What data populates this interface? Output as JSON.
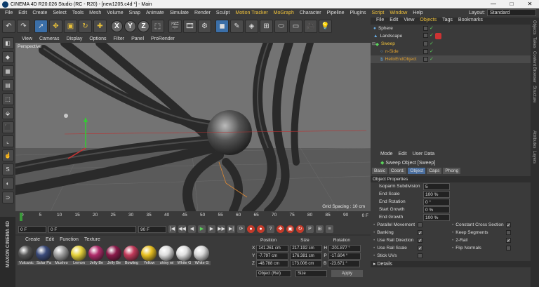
{
  "title": "CINEMA 4D R20.026 Studio (RC - R20) - [new1205.c4d *] - Main",
  "window_controls": {
    "minimize": "—",
    "maximize": "□",
    "close": "✕"
  },
  "menu": [
    "File",
    "Edit",
    "Create",
    "Select",
    "Tools",
    "Mesh",
    "Volume",
    "Snap",
    "Animate",
    "Simulate",
    "Render",
    "Sculpt",
    "Motion Tracker",
    "MoGraph",
    "Character",
    "Pipeline",
    "Plugins",
    "Script",
    "Window",
    "Help"
  ],
  "layout": {
    "label": "Layout:",
    "value": "Standard"
  },
  "viewport": {
    "menu": [
      "View",
      "Cameras",
      "Display",
      "Options",
      "Filter",
      "Panel",
      "ProRender"
    ],
    "label": "Perspective",
    "grid_spacing": "Grid Spacing : 10 cm"
  },
  "timeline": {
    "ticks": [
      "0",
      "5",
      "10",
      "15",
      "20",
      "25",
      "30",
      "35",
      "40",
      "45",
      "50",
      "55",
      "60",
      "65",
      "70",
      "75",
      "80",
      "85",
      "90"
    ],
    "end_label": "0 F",
    "fields": {
      "start": "0 F",
      "current": "0 F",
      "preview_end": "90 F",
      "end": "90 F"
    }
  },
  "materials": {
    "menu": [
      "Create",
      "Edit",
      "Function",
      "Texture"
    ],
    "items": [
      {
        "label": "Vulcanic",
        "color": "#555555"
      },
      {
        "label": "Solar Pa",
        "color": "#3a4a7a"
      },
      {
        "label": "Mushro",
        "color": "#a0a0a0"
      },
      {
        "label": "Lemon",
        "color": "#e6d23a"
      },
      {
        "label": "Jelly Be",
        "color": "#b02a6a"
      },
      {
        "label": "Jelly Be",
        "color": "#8a1a4a"
      },
      {
        "label": "Bowling",
        "color": "#c23a5a"
      },
      {
        "label": "Yellow",
        "color": "#e8c020"
      },
      {
        "label": "shiny wi",
        "color": "#dddddd"
      },
      {
        "label": "White G",
        "color": "#e0e0e0"
      },
      {
        "label": "White G",
        "color": "#d8d8d8"
      }
    ]
  },
  "coords": {
    "headers": [
      "Position",
      "Size",
      "Rotation"
    ],
    "rows": [
      {
        "axis": "X",
        "pos": "141.261 cm",
        "size": "217.192 cm",
        "rot_axis": "H",
        "rot": "-201.877 °"
      },
      {
        "axis": "Y",
        "pos": "-7.797 cm",
        "size": "176.381 cm",
        "rot_axis": "P",
        "rot": "-17.604 °"
      },
      {
        "axis": "Z",
        "pos": "-48.788 cm",
        "size": "173.006 cm",
        "rot_axis": "B",
        "rot": "-23.671 °"
      }
    ],
    "mode": "Object (Rel)",
    "size_mode": "Size",
    "apply": "Apply"
  },
  "objects": {
    "tabs": [
      "File",
      "Edit",
      "View",
      "Objects",
      "Tags",
      "Bookmarks"
    ],
    "active_tab": "Objects",
    "items": [
      {
        "name": "Sphere",
        "color": "#dddddd"
      },
      {
        "name": "Landscape",
        "color": "#dddddd"
      },
      {
        "name": "Sweep",
        "color": "#f0c23a"
      },
      {
        "name": "n-Side",
        "color": "#e0a030"
      },
      {
        "name": "HelixEndObject",
        "color": "#e0a030"
      }
    ]
  },
  "attributes": {
    "menu": [
      "Mode",
      "Edit",
      "User Data"
    ],
    "title": "Sweep Object [Sweep]",
    "tabs": [
      "Basic",
      "Coord.",
      "Object",
      "Caps",
      "Phong"
    ],
    "active_tab": "Object",
    "section": "Object Properties",
    "props": [
      {
        "label": "Isoparm Subdivision",
        "value": "5"
      },
      {
        "label": "End Scale",
        "value": "100 %"
      },
      {
        "label": "End Rotation",
        "value": "0 °"
      },
      {
        "label": "Start Growth",
        "value": "0 %"
      },
      {
        "label": "End Growth",
        "value": "100 %"
      }
    ],
    "checks_left": [
      {
        "label": "Parallel Movement",
        "checked": false
      },
      {
        "label": "Banking",
        "checked": true
      },
      {
        "label": "Use Rail Direction",
        "checked": true
      },
      {
        "label": "Use Rail Scale",
        "checked": true
      },
      {
        "label": "Stick UVs",
        "checked": false
      }
    ],
    "checks_right": [
      {
        "label": "Constant Cross Section",
        "checked": true
      },
      {
        "label": "Keep Segments",
        "checked": false
      },
      {
        "label": "2-Rail",
        "checked": true
      },
      {
        "label": "Flip Normals",
        "checked": false
      }
    ],
    "details": "Details"
  },
  "right_strip": [
    "Objects",
    "Takes",
    "Content Browser",
    "Structure",
    "Attributes",
    "Layers"
  ],
  "branding": "MAXON CINEMA 4D"
}
